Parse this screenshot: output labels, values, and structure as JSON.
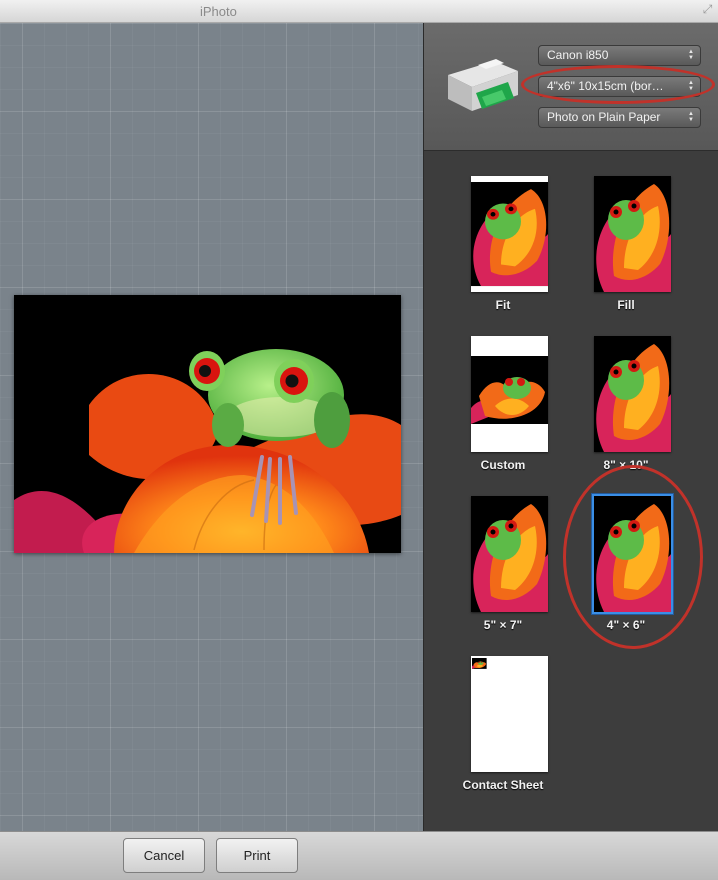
{
  "window": {
    "title": "iPhoto"
  },
  "printer": {
    "printer_name": "Canon i850",
    "paper_size": "4\"x6\" 10x15cm (bor…",
    "paper_type": "Photo on Plain Paper"
  },
  "layouts": [
    {
      "label": "Fit"
    },
    {
      "label": "Fill"
    },
    {
      "label": "Custom"
    },
    {
      "label": "8\" × 10\""
    },
    {
      "label": "5\" × 7\""
    },
    {
      "label": "4\" × 6\"",
      "selected": true
    },
    {
      "label": "Contact Sheet"
    }
  ],
  "buttons": {
    "cancel": "Cancel",
    "print": "Print"
  },
  "colors": {
    "annotation_ring": "#c1322a",
    "selection": "#3a8ee6"
  }
}
